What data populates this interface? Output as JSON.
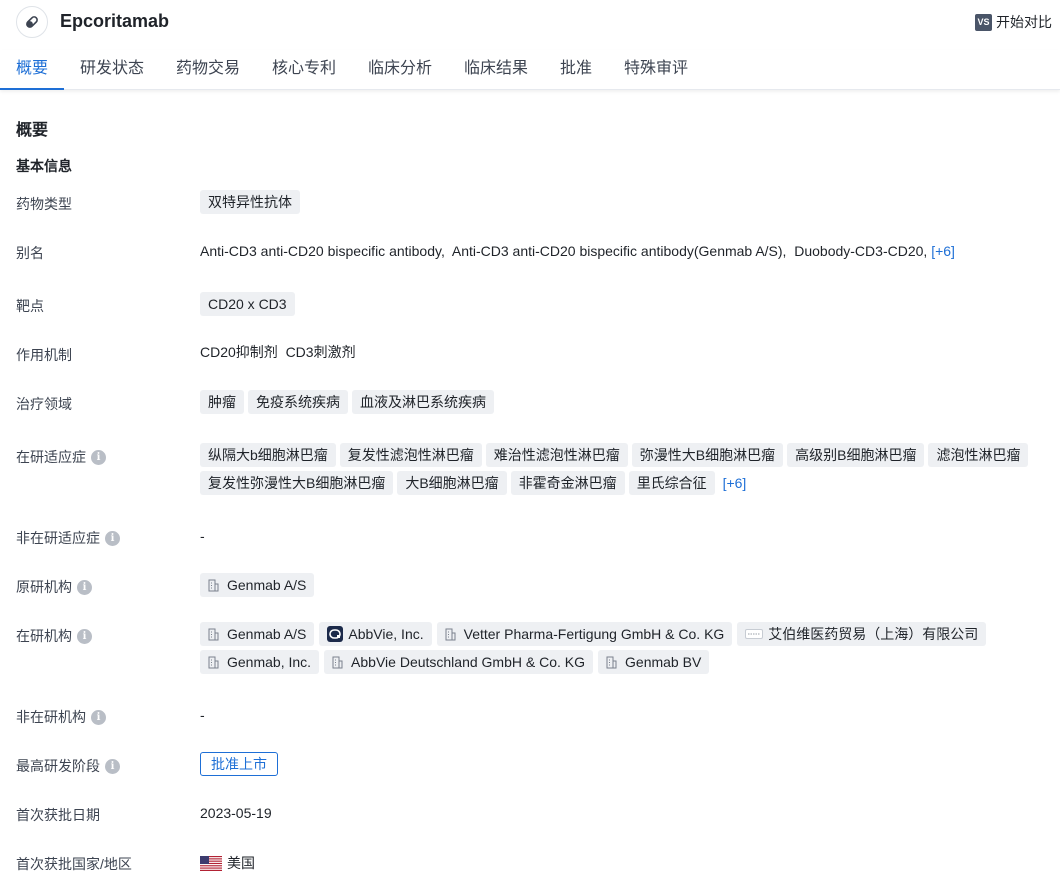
{
  "header": {
    "drug_name": "Epcoritamab",
    "compare_badge": "VS",
    "compare_label": "开始对比"
  },
  "tabs": [
    "概要",
    "研发状态",
    "药物交易",
    "核心专利",
    "临床分析",
    "临床结果",
    "批准",
    "特殊审评"
  ],
  "section_title": "概要",
  "sub_title": "基本信息",
  "fields": {
    "drug_type": {
      "label": "药物类型",
      "tags": [
        "双特异性抗体"
      ]
    },
    "alias": {
      "label": "别名",
      "text": "Anti-CD3 anti-CD20 bispecific antibody,  Anti-CD3 anti-CD20 bispecific antibody(Genmab A/S),  Duobody-CD3-CD20,",
      "more": "[+6]"
    },
    "target": {
      "label": "靶点",
      "tags": [
        "CD20 x CD3"
      ]
    },
    "mechanism": {
      "label": "作用机制",
      "text": "CD20抑制剂  CD3刺激剂"
    },
    "therapeutic_area": {
      "label": "治疗领域",
      "tags": [
        "肿瘤",
        "免疫系统疾病",
        "血液及淋巴系统疾病"
      ]
    },
    "active_indications": {
      "label": "在研适应症",
      "info": "i",
      "row1": [
        "纵隔大b细胞淋巴瘤",
        "复发性滤泡性淋巴瘤",
        "难治性滤泡性淋巴瘤",
        "弥漫性大B细胞淋巴瘤",
        "高级别B细胞淋巴瘤",
        "滤泡性淋巴瘤"
      ],
      "row2": [
        "复发性弥漫性大B细胞淋巴瘤",
        "大B细胞淋巴瘤",
        "非霍奇金淋巴瘤",
        "里氏综合征"
      ],
      "more": "[+6]"
    },
    "inactive_indications": {
      "label": "非在研适应症",
      "info": "i",
      "text": "-"
    },
    "originator": {
      "label": "原研机构",
      "info": "i",
      "orgs": [
        "Genmab A/S"
      ]
    },
    "active_orgs": {
      "label": "在研机构",
      "info": "i",
      "row1": [
        {
          "name": "Genmab A/S",
          "logo": "building-icon"
        },
        {
          "name": "AbbVie, Inc.",
          "logo": "abbvie-logo"
        },
        {
          "name": "Vetter Pharma-Fertigung GmbH & Co. KG",
          "logo": "building-icon"
        },
        {
          "name": "艾伯维医药贸易（上海）有限公司",
          "logo": "abbvie-cn-logo"
        }
      ],
      "row2": [
        {
          "name": "Genmab, Inc.",
          "logo": "building-icon"
        },
        {
          "name": "AbbVie Deutschland GmbH & Co. KG",
          "logo": "building-icon"
        },
        {
          "name": "Genmab BV",
          "logo": "building-icon"
        }
      ]
    },
    "inactive_orgs": {
      "label": "非在研机构",
      "info": "i",
      "text": "-"
    },
    "highest_phase": {
      "label": "最高研发阶段",
      "info": "i",
      "stage": "批准上市"
    },
    "first_approval_date": {
      "label": "首次获批日期",
      "text": "2023-05-19"
    },
    "first_approval_country": {
      "label": "首次获批国家/地区",
      "text": "美国",
      "flag": "us-flag-icon"
    }
  },
  "colors": {
    "accent": "#1e6fd6",
    "tag_bg": "#eef0f3",
    "text": "#1f2329",
    "label": "#3d4451"
  }
}
